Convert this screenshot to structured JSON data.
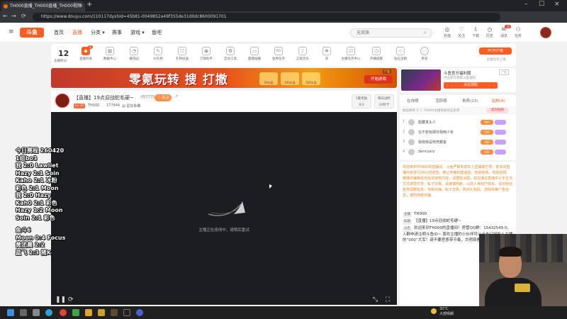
{
  "browser": {
    "tab_title": "TH000直播_TH000直播_TH000视频",
    "tab_close": "×",
    "new_tab": "+",
    "url": "https://www.douyu.com/110117dyshid=45b81-0049852a49f355de31d0dc8600091701",
    "minimize": "–",
    "maximize": "☐",
    "close": "×",
    "back": "←",
    "forward": "→",
    "reload": "⟳"
  },
  "header": {
    "logo": "斗鱼",
    "nav": [
      {
        "label": "首页"
      },
      {
        "label": "直播"
      },
      {
        "label": "分类 ▾"
      },
      {
        "label": "赛事"
      },
      {
        "label": "游戏 ▾"
      },
      {
        "label": "鱼吧"
      }
    ],
    "search_placeholder": "无双旗",
    "search_icon": "⌕",
    "icons": [
      {
        "glyph": "◎",
        "label": "充值"
      },
      {
        "glyph": "♡",
        "label": "关注"
      },
      {
        "glyph": "⇩",
        "label": "下载"
      },
      {
        "glyph": "◷",
        "label": "历史"
      },
      {
        "glyph": "✉",
        "label": "消息"
      },
      {
        "glyph": "⚇",
        "label": "任务"
      }
    ],
    "message_count": "18"
  },
  "features": {
    "level_number": "12",
    "level_sub": "主播积分",
    "items": [
      {
        "glyph": "◆",
        "label": "直播开关"
      },
      {
        "glyph": "▦",
        "label": "数据中心"
      },
      {
        "glyph": "◔",
        "label": "播花园"
      },
      {
        "glyph": "✎",
        "label": "AI礼物"
      },
      {
        "glyph": "⛫",
        "label": "礼物投送"
      },
      {
        "glyph": "◉",
        "label": "刀锋助手"
      },
      {
        "glyph": "✿",
        "label": "互动工具"
      },
      {
        "glyph": "▭",
        "label": "面膜插播"
      },
      {
        "glyph": "AD",
        "label": "鱼秀任务"
      },
      {
        "glyph": "♪",
        "label": "正能音乐"
      },
      {
        "glyph": "❖",
        "label": "赏"
      },
      {
        "glyph": "☑",
        "label": "主播任务中心"
      },
      {
        "glyph": "◷",
        "label": "开播提醒"
      },
      {
        "glyph": "◇",
        "label": "钻石宝箱"
      },
      {
        "glyph": "⋯",
        "label": "更多"
      }
    ],
    "badge": "3",
    "pc_button": "PC开户端",
    "pc_sub": "主播任务上线"
  },
  "banner": {
    "title": "零氪玩转 搜 打撤",
    "chips": [
      "24水晶",
      "100水晶",
      "500水晶"
    ],
    "play_button": "开始游戏",
    "ad_tag": "广告"
  },
  "stream": {
    "title": "【直播】19点迎战蛇毛硬~",
    "views": "457775",
    "follow": "♡ 关注",
    "share": "⇗",
    "level_badge": "Lv 30",
    "name": "TH000",
    "room_id": "177844",
    "category": "▤ 星际争霸",
    "btn1_line1": "1重奖励",
    "btn1_line2": "0/3",
    "btn2_line1": "每日试听",
    "btn2_line2": "20秒卡"
  },
  "player": {
    "message": "主播正在连线中，请稍后重试",
    "pause": "❚❚",
    "refresh": "⟳",
    "fullscreen1": "⤡",
    "fullscreen2": "⛶"
  },
  "overlay": {
    "lines": [
      "今日赛程 260420",
      "1组bo3",
      "我    2:0 Lawliet",
      "Hazy 2:1 Soin",
      "Kaho 2:1 冰粉",
      "彩色  2:1 Moon",
      "我    2:0 Hazy",
      "Kah0 2:1 彩色",
      "Hazy 1:2 Moon",
      "Soin 2:1 彩色"
    ],
    "lines2": [
      "鱼斗6",
      "Moon 0:4 Focus",
      "黄团晨 2:2",
      "蓝飞  2:3 猪K"
    ]
  },
  "right_ad": {
    "title": "斗鱼官方福利圈",
    "sub": "点击即可领取斗鱼福利",
    "button": "点击领取",
    "tag": "广告"
  },
  "ranking": {
    "tabs": [
      "在线榜",
      "活跃榜",
      "贵宾(23)",
      "钻粉(8)"
    ],
    "sub_left": "粉丝榜单  5  ⓘ  TH000主播等级对应名单",
    "sub_btn": "成为钻粉",
    "rows": [
      {
        "num": "1",
        "name": "腊藏真头人",
        "badge": "000"
      },
      {
        "num": "2",
        "name": "在不若有期许我两少年",
        "badge": "000"
      },
      {
        "num": "3",
        "name": "我我我是电竞霸金",
        "badge": "000"
      },
      {
        "num": "4",
        "name": "dannyary",
        "badge": "000"
      }
    ]
  },
  "chat": {
    "notice": "欢迎来到TH000的直播间。斗鱼严禁未成年人直播或打赏。依法对直播内容进行24小时巡查，禁止传播封建迷信、低俗色情、低俗自残、赌博诈骗等任何违法违规内容。请理性消费，如主播在直播中以不正当方式诱导打赏、私下交易、请谨慎判断，以防人身财产损失。请勿轻信各类招聘信息、代练代抽、私下交易、购买礼包码、游戏币等广告信息，谨防网络诈骗。",
    "lines": [
      {
        "tag": "主播",
        "text": "TH000"
      },
      {
        "tag": "标题",
        "text": "【直播】19点迎战蛇毛硬~"
      },
      {
        "tag": "公告",
        "text": "欢迎来到TH000的直播间！房管QQ群：15432549 0，入群申请注明斗鱼ID~ 喜欢主播的小伙伴可以点击订阅加入主播的“000”大军！请不要恶意带节奏，文明观看直播。"
      }
    ]
  },
  "taskbar": {
    "temp_line1": "30°C",
    "temp_line2": "大部晴朗"
  },
  "colors": {
    "accent": "#ff5d23",
    "player_bg": "#1c1d20",
    "notice": "#f08a2a"
  }
}
